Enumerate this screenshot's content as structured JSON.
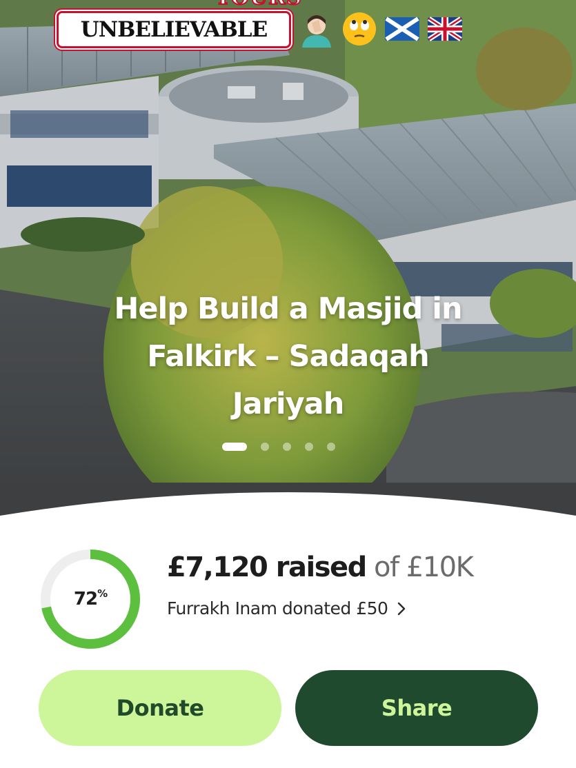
{
  "overlay": {
    "top_clip_text": "YOURS",
    "banner_text": "UNBELIEVABLE",
    "emojis": [
      "facepalm-emoji",
      "eye-roll-emoji",
      "scotland-flag",
      "uk-flag"
    ]
  },
  "hero": {
    "title": "Help Build a Masjid in Falkirk – Sadaqah Jariyah",
    "slide_count": 5,
    "active_slide": 1
  },
  "progress": {
    "percent_label": "72",
    "percent_symbol": "%",
    "fraction": 0.72
  },
  "fundraiser": {
    "raised_amount": "£7,120 raised",
    "goal_text": "of £10K",
    "latest_donation": "Furrakh Inam donated £50"
  },
  "actions": {
    "donate_label": "Donate",
    "share_label": "Share"
  },
  "colors": {
    "accent_light": "#cdf599",
    "accent_dark": "#1f4a2e",
    "ring_green": "#5cbf3e",
    "ring_track": "#eeeeee",
    "banner_red": "#c8102e"
  }
}
